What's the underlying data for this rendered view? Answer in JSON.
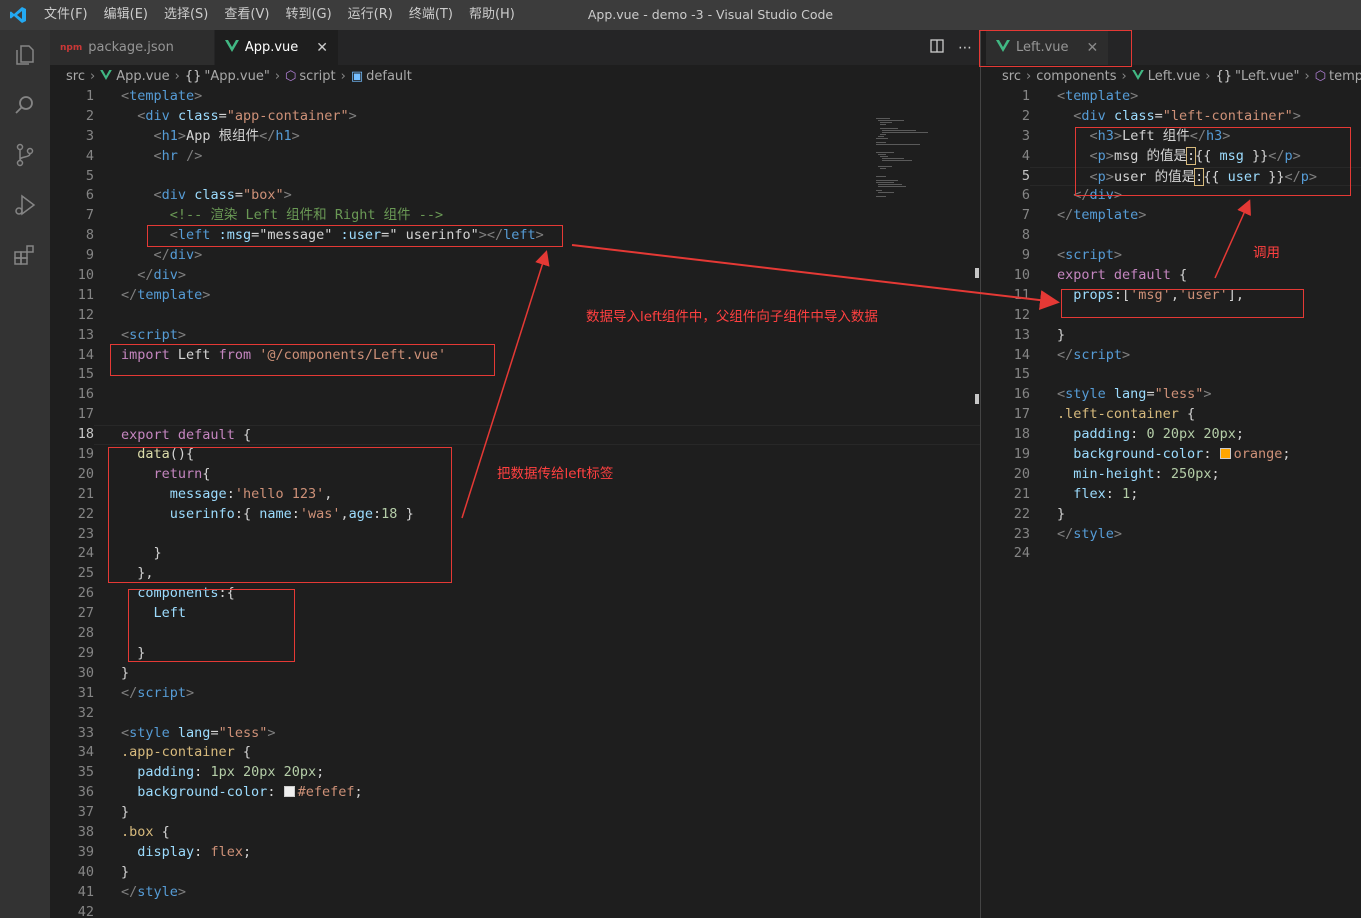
{
  "window": {
    "title": "App.vue - demo -3 - Visual Studio Code",
    "menu": [
      "文件(F)",
      "编辑(E)",
      "选择(S)",
      "查看(V)",
      "转到(G)",
      "运行(R)",
      "终端(T)",
      "帮助(H)"
    ]
  },
  "activity_bar": [
    "files-icon",
    "search-icon",
    "source-control-icon",
    "run-debug-icon",
    "extensions-icon"
  ],
  "left_editor": {
    "tabs": [
      {
        "label": "package.json",
        "icon": "npm-icon",
        "active": false
      },
      {
        "label": "App.vue",
        "icon": "vue-icon",
        "active": true,
        "close": "✕"
      }
    ],
    "breadcrumb": [
      "src",
      "App.vue",
      "\"App.vue\"",
      "script",
      "default"
    ],
    "current_line": 18,
    "lines": [
      [
        [
          "t",
          "<"
        ],
        [
          "tn",
          "template"
        ],
        [
          "t",
          ">"
        ]
      ],
      [
        [
          "w",
          "  "
        ],
        [
          "t",
          "<"
        ],
        [
          "tn",
          "div"
        ],
        [
          "w",
          " "
        ],
        [
          "at",
          "class"
        ],
        [
          "w",
          "="
        ],
        [
          "s",
          "\"app-container\""
        ],
        [
          "t",
          ">"
        ]
      ],
      [
        [
          "w",
          "    "
        ],
        [
          "t",
          "<"
        ],
        [
          "tn",
          "h1"
        ],
        [
          "t",
          ">"
        ],
        [
          "w",
          "App 根组件"
        ],
        [
          "t",
          "</"
        ],
        [
          "tn",
          "h1"
        ],
        [
          "t",
          ">"
        ]
      ],
      [
        [
          "w",
          "    "
        ],
        [
          "t",
          "<"
        ],
        [
          "tn",
          "hr"
        ],
        [
          "w",
          " "
        ],
        [
          "t",
          "/>"
        ]
      ],
      [
        [
          "w",
          ""
        ]
      ],
      [
        [
          "w",
          "    "
        ],
        [
          "t",
          "<"
        ],
        [
          "tn",
          "div"
        ],
        [
          "w",
          " "
        ],
        [
          "at",
          "class"
        ],
        [
          "w",
          "="
        ],
        [
          "s",
          "\"box\""
        ],
        [
          "t",
          ">"
        ]
      ],
      [
        [
          "w",
          "      "
        ],
        [
          "c",
          "<!-- 渲染 Left 组件和 Right 组件 -->"
        ]
      ],
      [
        [
          "w",
          "      "
        ],
        [
          "t",
          "<"
        ],
        [
          "tn",
          "left"
        ],
        [
          "w",
          " "
        ],
        [
          "at",
          ":msg"
        ],
        [
          "w",
          "="
        ],
        [
          "w",
          "\"message\""
        ],
        [
          "w",
          " "
        ],
        [
          "at",
          ":user"
        ],
        [
          "w",
          "="
        ],
        [
          "w",
          "\" userinfo\""
        ],
        [
          "t",
          "></"
        ],
        [
          "tn",
          "left"
        ],
        [
          "t",
          ">"
        ]
      ],
      [
        [
          "w",
          "    "
        ],
        [
          "t",
          "</"
        ],
        [
          "tn",
          "div"
        ],
        [
          "t",
          ">"
        ]
      ],
      [
        [
          "w",
          "  "
        ],
        [
          "t",
          "</"
        ],
        [
          "tn",
          "div"
        ],
        [
          "t",
          ">"
        ]
      ],
      [
        [
          "t",
          "</"
        ],
        [
          "tn",
          "template"
        ],
        [
          "t",
          ">"
        ]
      ],
      [
        [
          "w",
          ""
        ]
      ],
      [
        [
          "t",
          "<"
        ],
        [
          "tn",
          "script"
        ],
        [
          "t",
          ">"
        ]
      ],
      [
        [
          "k",
          "import"
        ],
        [
          "w",
          " Left "
        ],
        [
          "k",
          "from"
        ],
        [
          "w",
          " "
        ],
        [
          "s",
          "'@/components/Left.vue'"
        ]
      ],
      [
        [
          "w",
          ""
        ]
      ],
      [
        [
          "w",
          ""
        ]
      ],
      [
        [
          "w",
          ""
        ]
      ],
      [
        [
          "k",
          "export"
        ],
        [
          "w",
          " "
        ],
        [
          "k",
          "default"
        ],
        [
          "w",
          " {"
        ]
      ],
      [
        [
          "w",
          "  "
        ],
        [
          "f",
          "data"
        ],
        [
          "w",
          "(){"
        ]
      ],
      [
        [
          "w",
          "    "
        ],
        [
          "k",
          "return"
        ],
        [
          "w",
          "{"
        ]
      ],
      [
        [
          "w",
          "      "
        ],
        [
          "at",
          "message"
        ],
        [
          "w",
          ":"
        ],
        [
          "s",
          "'hello 123'"
        ],
        [
          "w",
          ","
        ]
      ],
      [
        [
          "w",
          "      "
        ],
        [
          "at",
          "userinfo"
        ],
        [
          "w",
          ":{ "
        ],
        [
          "at",
          "name"
        ],
        [
          "w",
          ":"
        ],
        [
          "s",
          "'was'"
        ],
        [
          "w",
          ","
        ],
        [
          "at",
          "age"
        ],
        [
          "w",
          ":"
        ],
        [
          "n",
          "18"
        ],
        [
          "w",
          " }"
        ]
      ],
      [
        [
          "w",
          ""
        ]
      ],
      [
        [
          "w",
          "    }"
        ]
      ],
      [
        [
          "w",
          "  },"
        ]
      ],
      [
        [
          "w",
          "  "
        ],
        [
          "at",
          "components"
        ],
        [
          "w",
          ":{"
        ]
      ],
      [
        [
          "w",
          "    "
        ],
        [
          "at",
          "Left"
        ]
      ],
      [
        [
          "w",
          ""
        ]
      ],
      [
        [
          "w",
          "  }"
        ]
      ],
      [
        [
          "w",
          "}"
        ]
      ],
      [
        [
          "t",
          "</"
        ],
        [
          "tn",
          "script"
        ],
        [
          "t",
          ">"
        ]
      ],
      [
        [
          "w",
          ""
        ]
      ],
      [
        [
          "t",
          "<"
        ],
        [
          "tn",
          "style"
        ],
        [
          "w",
          " "
        ],
        [
          "at",
          "lang"
        ],
        [
          "w",
          "="
        ],
        [
          "s",
          "\"less\""
        ],
        [
          "t",
          ">"
        ]
      ],
      [
        [
          "sel",
          ".app-container"
        ],
        [
          "w",
          " {"
        ]
      ],
      [
        [
          "w",
          "  "
        ],
        [
          "at",
          "padding"
        ],
        [
          "w",
          ": "
        ],
        [
          "n",
          "1px"
        ],
        [
          "w",
          " "
        ],
        [
          "n",
          "20px"
        ],
        [
          "w",
          " "
        ],
        [
          "n",
          "20px"
        ],
        [
          "w",
          ";"
        ]
      ],
      [
        [
          "w",
          "  "
        ],
        [
          "at",
          "background-color"
        ],
        [
          "w",
          ": "
        ],
        [
          "swatch",
          "#efefef"
        ],
        [
          "s",
          "#efefef"
        ],
        [
          "w",
          ";"
        ]
      ],
      [
        [
          "w",
          "}"
        ]
      ],
      [
        [
          "sel",
          ".box"
        ],
        [
          "w",
          " {"
        ]
      ],
      [
        [
          "w",
          "  "
        ],
        [
          "at",
          "display"
        ],
        [
          "w",
          ": "
        ],
        [
          "s",
          "flex"
        ],
        [
          "w",
          ";"
        ]
      ],
      [
        [
          "w",
          "}"
        ]
      ],
      [
        [
          "t",
          "</"
        ],
        [
          "tn",
          "style"
        ],
        [
          "t",
          ">"
        ]
      ],
      [
        [
          "w",
          ""
        ]
      ]
    ]
  },
  "right_editor": {
    "tabs": [
      {
        "label": "Left.vue",
        "icon": "vue-icon",
        "active": false,
        "close": "✕"
      }
    ],
    "breadcrumb": [
      "src",
      "components",
      "Left.vue",
      "\"Left.vue\"",
      "templ"
    ],
    "current_line": 5,
    "lines": [
      [
        [
          "t",
          "<"
        ],
        [
          "tn",
          "template"
        ],
        [
          "t",
          ">"
        ]
      ],
      [
        [
          "w",
          "  "
        ],
        [
          "t",
          "<"
        ],
        [
          "tn",
          "div"
        ],
        [
          "w",
          " "
        ],
        [
          "at",
          "class"
        ],
        [
          "w",
          "="
        ],
        [
          "s",
          "\"left-container\""
        ],
        [
          "t",
          ">"
        ]
      ],
      [
        [
          "w",
          "    "
        ],
        [
          "t",
          "<"
        ],
        [
          "tn",
          "h3"
        ],
        [
          "t",
          ">"
        ],
        [
          "w",
          "Left 组件"
        ],
        [
          "t",
          "</"
        ],
        [
          "tn",
          "h3"
        ],
        [
          "t",
          ">"
        ]
      ],
      [
        [
          "w",
          "    "
        ],
        [
          "t",
          "<"
        ],
        [
          "tn",
          "p"
        ],
        [
          "t",
          ">"
        ],
        [
          "w",
          "msg 的值是"
        ],
        [
          "hl",
          ":"
        ],
        [
          "w",
          "{{ "
        ],
        [
          "at",
          "msg"
        ],
        [
          "w",
          " }}"
        ],
        [
          "t",
          "</"
        ],
        [
          "tn",
          "p"
        ],
        [
          "t",
          ">"
        ]
      ],
      [
        [
          "w",
          "    "
        ],
        [
          "t",
          "<"
        ],
        [
          "tn",
          "p"
        ],
        [
          "t",
          ">"
        ],
        [
          "w",
          "user 的值是"
        ],
        [
          "hl",
          ":"
        ],
        [
          "w",
          "{{ "
        ],
        [
          "at",
          "user"
        ],
        [
          "w",
          " }}"
        ],
        [
          "t",
          "</"
        ],
        [
          "tn",
          "p"
        ],
        [
          "t",
          ">"
        ]
      ],
      [
        [
          "w",
          "  "
        ],
        [
          "t",
          "</"
        ],
        [
          "tn",
          "div"
        ],
        [
          "t",
          ">"
        ]
      ],
      [
        [
          "t",
          "</"
        ],
        [
          "tn",
          "template"
        ],
        [
          "t",
          ">"
        ]
      ],
      [
        [
          "w",
          ""
        ]
      ],
      [
        [
          "t",
          "<"
        ],
        [
          "tn",
          "script"
        ],
        [
          "t",
          ">"
        ]
      ],
      [
        [
          "k",
          "export"
        ],
        [
          "w",
          " "
        ],
        [
          "k",
          "default"
        ],
        [
          "w",
          " {"
        ]
      ],
      [
        [
          "w",
          "  "
        ],
        [
          "at",
          "props"
        ],
        [
          "w",
          ":["
        ],
        [
          "s",
          "'msg'"
        ],
        [
          "w",
          ","
        ],
        [
          "s",
          "'user'"
        ],
        [
          "w",
          "],"
        ]
      ],
      [
        [
          "w",
          ""
        ]
      ],
      [
        [
          "w",
          "}"
        ]
      ],
      [
        [
          "t",
          "</"
        ],
        [
          "tn",
          "script"
        ],
        [
          "t",
          ">"
        ]
      ],
      [
        [
          "w",
          ""
        ]
      ],
      [
        [
          "t",
          "<"
        ],
        [
          "tn",
          "style"
        ],
        [
          "w",
          " "
        ],
        [
          "at",
          "lang"
        ],
        [
          "w",
          "="
        ],
        [
          "s",
          "\"less\""
        ],
        [
          "t",
          ">"
        ]
      ],
      [
        [
          "sel",
          ".left-container"
        ],
        [
          "w",
          " {"
        ]
      ],
      [
        [
          "w",
          "  "
        ],
        [
          "at",
          "padding"
        ],
        [
          "w",
          ": "
        ],
        [
          "n",
          "0"
        ],
        [
          "w",
          " "
        ],
        [
          "n",
          "20px"
        ],
        [
          "w",
          " "
        ],
        [
          "n",
          "20px"
        ],
        [
          "w",
          ";"
        ]
      ],
      [
        [
          "w",
          "  "
        ],
        [
          "at",
          "background-color"
        ],
        [
          "w",
          ": "
        ],
        [
          "swatch",
          "orange"
        ],
        [
          "s",
          "orange"
        ],
        [
          "w",
          ";"
        ]
      ],
      [
        [
          "w",
          "  "
        ],
        [
          "at",
          "min-height"
        ],
        [
          "w",
          ": "
        ],
        [
          "n",
          "250px"
        ],
        [
          "w",
          ";"
        ]
      ],
      [
        [
          "w",
          "  "
        ],
        [
          "at",
          "flex"
        ],
        [
          "w",
          ": "
        ],
        [
          "n",
          "1"
        ],
        [
          "w",
          ";"
        ]
      ],
      [
        [
          "w",
          "}"
        ]
      ],
      [
        [
          "t",
          "</"
        ],
        [
          "tn",
          "style"
        ],
        [
          "t",
          ">"
        ]
      ],
      [
        [
          "w",
          ""
        ]
      ]
    ]
  },
  "annotations": {
    "note_import": "数据导入left组件中，父组件向子组件中导入数据",
    "note_pass": "把数据传给left标签",
    "note_call": "调用"
  },
  "colors": {
    "annotation_red": "#e53935",
    "vue_green": "#41b883",
    "editor_bg": "#1e1e1e"
  }
}
